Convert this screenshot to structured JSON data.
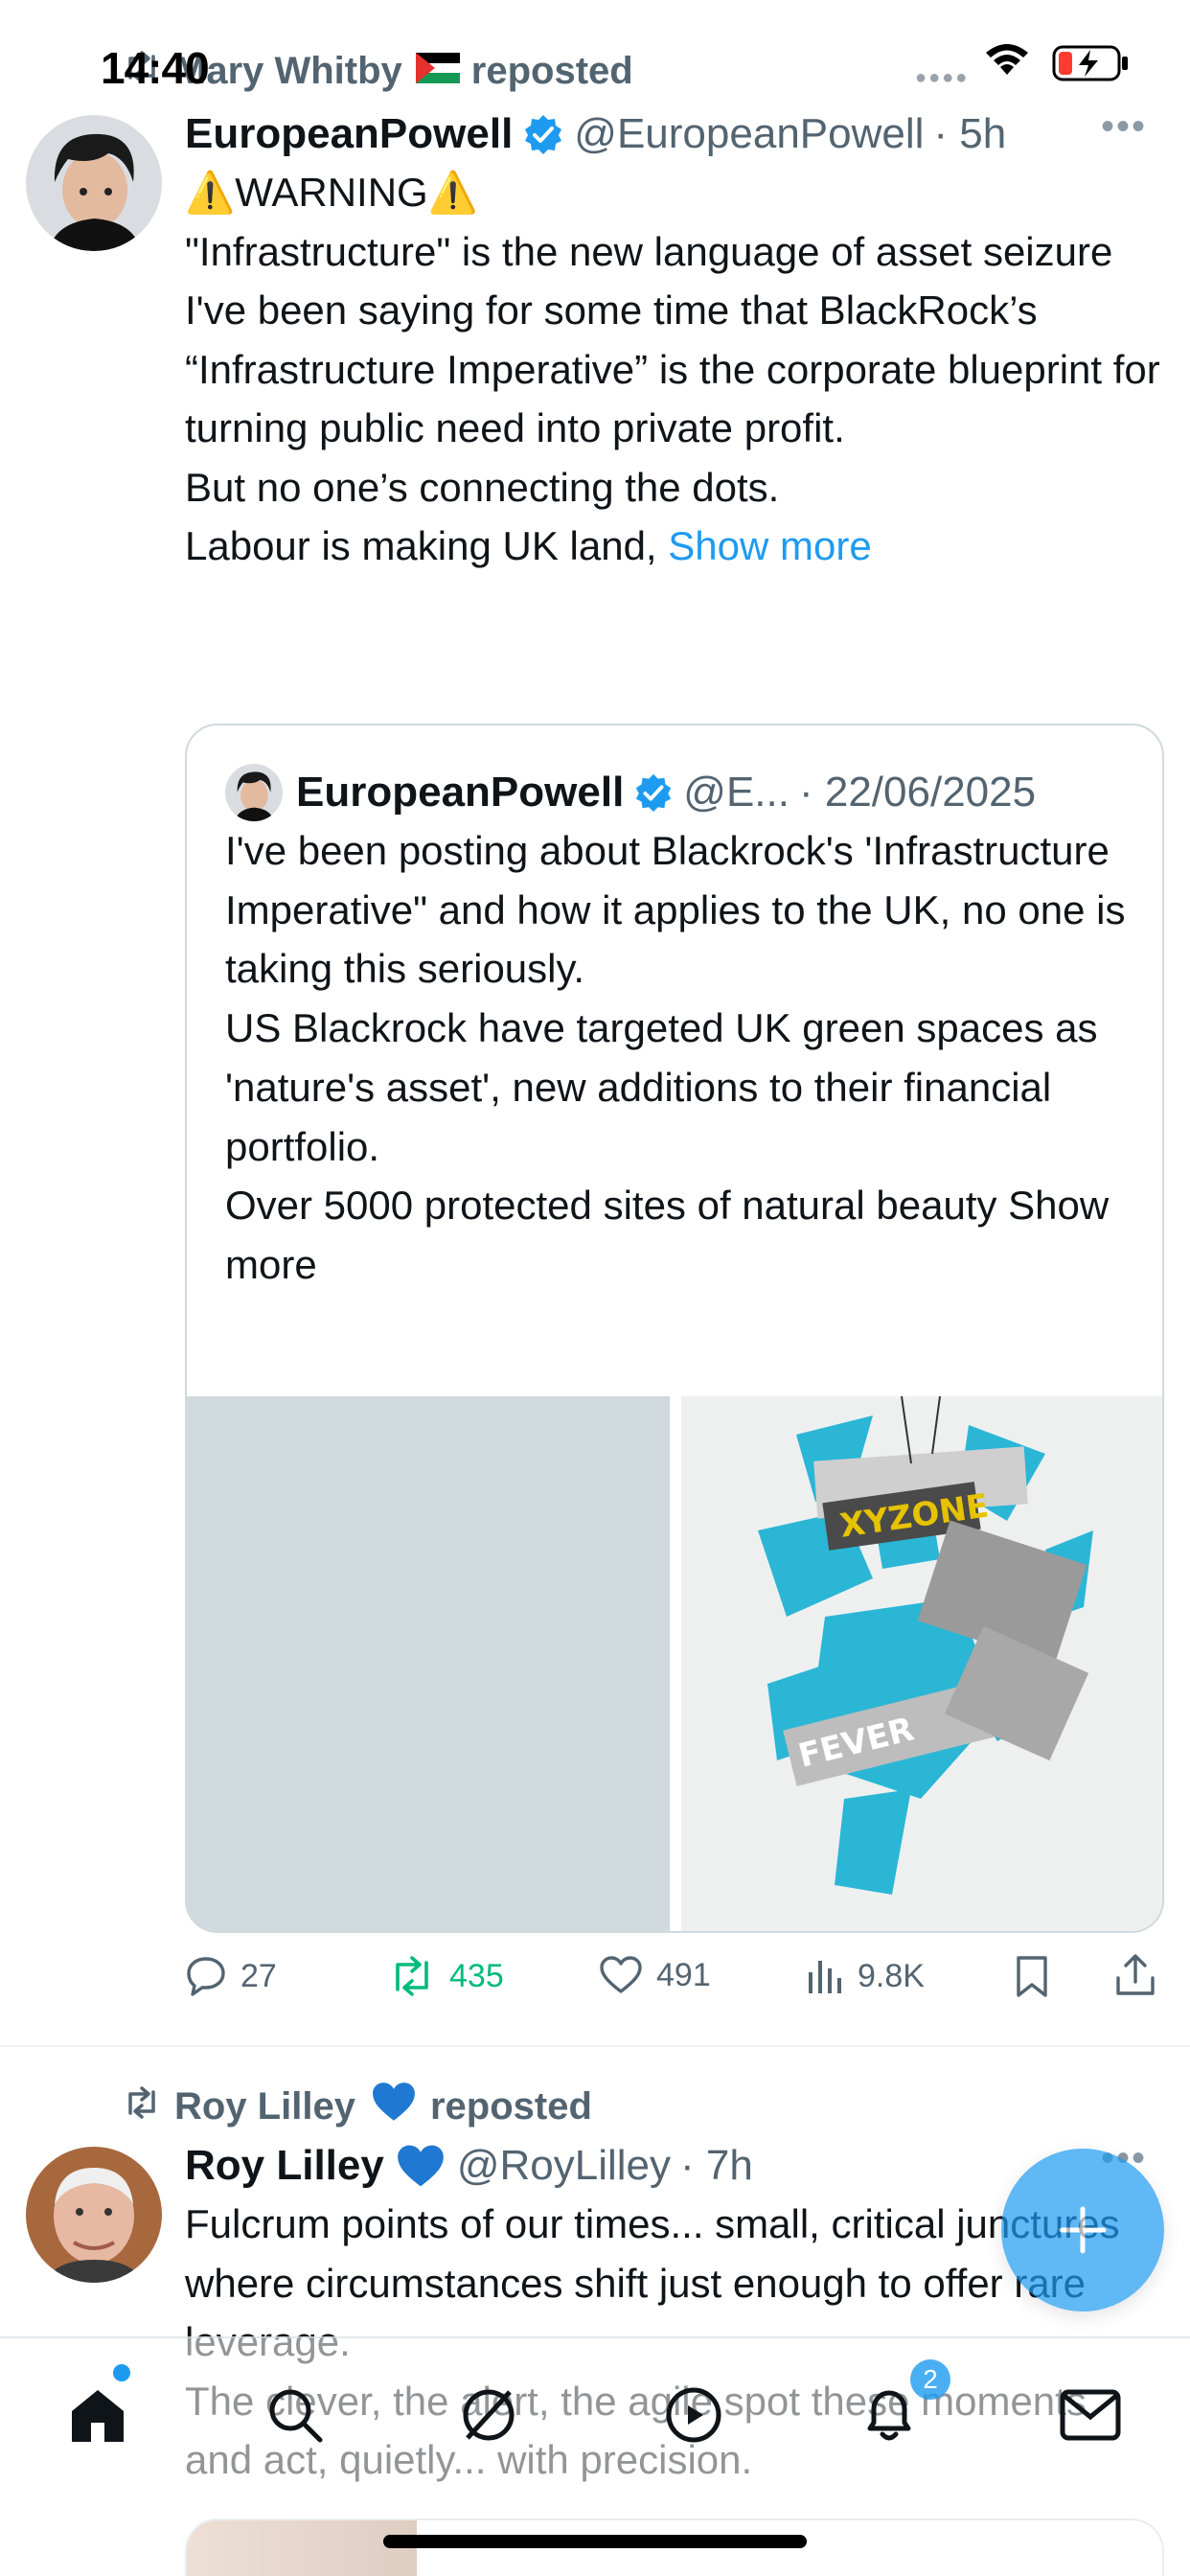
{
  "status_bar": {
    "time": "14:40"
  },
  "tweets": [
    {
      "social_context": "Mary Whitby",
      "social_context_suffix": "reposted",
      "author": {
        "name": "EuropeanPowell",
        "handle": "@EuropeanPowell",
        "time": "· 5h"
      },
      "text_lines": [
        "⚠️WARNING⚠️",
        "\"Infrastructure\" is the new language of asset seizure",
        "I've been saying for some time that BlackRock’s “Infrastructure Imperative” is the corporate blueprint for turning public need into private profit.",
        "But no one’s connecting the dots.",
        "Labour is making UK land, "
      ],
      "show_more": "Show more",
      "quote": {
        "name": "EuropeanPowell",
        "handle": "@E...",
        "date": "· 22/06/2025",
        "text": "I've been posting about Blackrock's 'Infrastructure Imperative\" and how it applies to the UK, no one is taking this seriously.\nUS Blackrock have targeted UK green spaces as 'nature's asset', new additions to their financial portfolio.\nOver 5000 protected sites of natural beauty",
        "show_more": "Show more",
        "image_texts": [
          "XYZONE",
          "FEVER"
        ]
      },
      "actions": {
        "replies": "27",
        "reposts": "435",
        "likes": "491",
        "views": "9.8K"
      }
    },
    {
      "social_context": "Roy Lilley",
      "social_context_suffix": "reposted",
      "author": {
        "name": "Roy Lilley",
        "handle": "@RoyLilley",
        "time": "· 7h"
      },
      "text": "Fulcrum points of our times... small, critical junctures where circumstances shift just enough to offer rare leverage.\nThe clever, the alert, the agile spot these moments and act, quietly... with precision."
    }
  ],
  "tab_bar": {
    "notifications_badge": "2",
    "items": [
      "home-icon",
      "search-icon",
      "grok-icon",
      "communities-icon",
      "notifications-icon",
      "messages-icon"
    ]
  },
  "colors": {
    "accent": "#1d9bf0",
    "repost_green": "#00ba7c",
    "secondary_text": "#536471"
  }
}
